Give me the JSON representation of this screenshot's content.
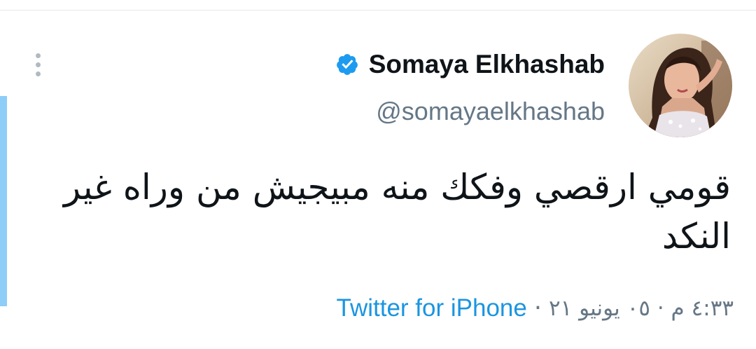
{
  "tweet": {
    "author": {
      "display_name": "Somaya Elkhashab",
      "handle": "@somayaelkhashab",
      "verified": true,
      "verified_icon": "verified-badge-icon",
      "avatar_icon": "profile-photo"
    },
    "text": "قومي ارقصي وفكك منه مبيجيش من وراه غير النكد",
    "timestamp": "٤:٣٣ م · ٠٥ يونيو ٢١",
    "separator": "·",
    "source": "Twitter for iPhone",
    "more_icon": "more-vertical-icon"
  },
  "colors": {
    "accent": "#1b95e0",
    "verified_blue": "#1d9bf0",
    "secondary_text": "#657786",
    "thread_bar": "#8ecdf7",
    "divider": "#e1e8ed"
  }
}
